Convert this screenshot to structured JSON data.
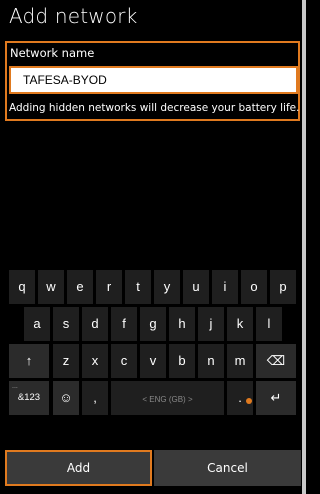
{
  "header": {
    "title": "Add network"
  },
  "form": {
    "network_name_label": "Network name",
    "network_name_value": "TAFESA-BYOD",
    "hint": "Adding hidden networks will decrease your battery life."
  },
  "keyboard": {
    "row1": [
      "q",
      "w",
      "e",
      "r",
      "t",
      "y",
      "u",
      "i",
      "o",
      "p"
    ],
    "row2": [
      "a",
      "s",
      "d",
      "f",
      "g",
      "h",
      "j",
      "k",
      "l"
    ],
    "row3": [
      "↑",
      "z",
      "x",
      "c",
      "v",
      "b",
      "n",
      "m",
      "⌫"
    ],
    "row4": {
      "numbers": "&123",
      "numbers_sub": "...",
      "emoji": "☺",
      "comma": ",",
      "space": "< ENG (GB) >",
      "period": ".",
      "enter": "↵"
    }
  },
  "buttons": {
    "add": "Add",
    "cancel": "Cancel"
  },
  "colors": {
    "accent": "#e07a1f",
    "background": "#000000"
  }
}
